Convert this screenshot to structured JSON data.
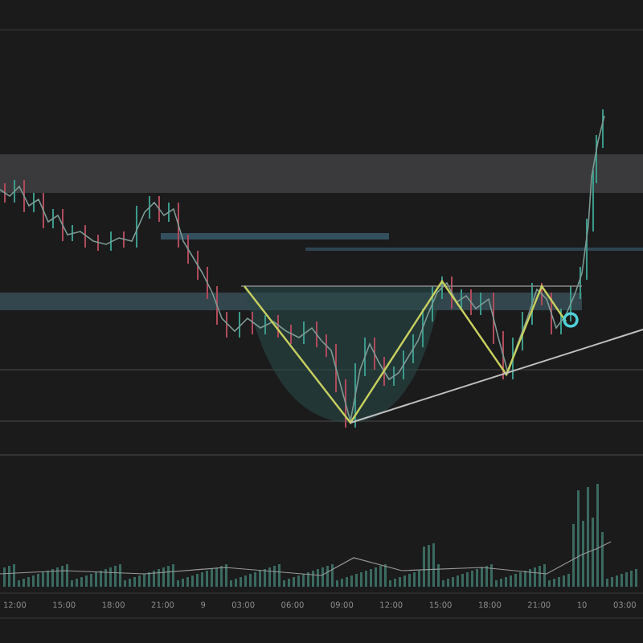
{
  "time_axis": {
    "labels": [
      "12:00",
      "15:00",
      "18:00",
      "21:00",
      "9",
      "03:00",
      "06:00",
      "09:00",
      "12:00",
      "15:00",
      "18:00",
      "21:00",
      "10",
      "03:00"
    ]
  }
}
